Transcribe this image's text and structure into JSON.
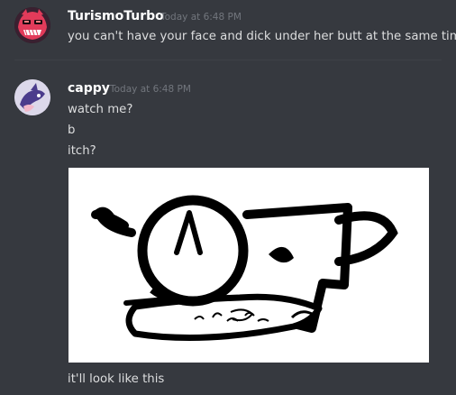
{
  "messages": [
    {
      "username": "TurismoTurbo",
      "timestamp": "Today at 6:48 PM",
      "lines": [
        "you can't have your face and dick under her butt at the same time"
      ]
    },
    {
      "username": "cappy",
      "timestamp": "Today at 6:48 PM",
      "lines": [
        "watch me?",
        "b",
        "itch?"
      ],
      "attachment": {
        "kind": "drawing-image"
      },
      "after_attachment": "it'll look like this"
    }
  ]
}
